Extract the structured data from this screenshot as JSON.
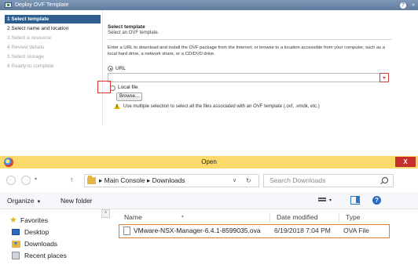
{
  "wizard": {
    "title": "Deploy OVF Template",
    "help_label": "?",
    "expand_label": "»",
    "steps": [
      {
        "label": "1  Select template",
        "state": "active"
      },
      {
        "label": "2  Select name and location",
        "state": "current"
      },
      {
        "label": "3  Select a resource",
        "state": "disabled"
      },
      {
        "label": "4  Review details",
        "state": "disabled"
      },
      {
        "label": "5  Select storage",
        "state": "disabled"
      },
      {
        "label": "6  Ready to complete",
        "state": "disabled"
      }
    ],
    "section_title": "Select template",
    "section_subtitle": "Select an OVF template.",
    "description": "Enter a URL to download and install the OVF package from the Internet, or browse to a location accessible from your computer, such as a local hard drive, a network share, or a CD/DVD drive.",
    "url_option_label": "URL",
    "url_value": "",
    "local_file_label": "Local file",
    "browse_label": "Browse...",
    "warning_text": "Use multiple selection to select all the files associated with an OVF template (.ovf, .vmdk, etc.)",
    "highlight_color": "#e0302a"
  },
  "open_dialog": {
    "title": "Open",
    "close_label": "X",
    "back_label": "←",
    "forward_label": "→",
    "up_label": "↑",
    "address": "▸ Main Console ▸ Downloads",
    "address_dropdown": "∨",
    "refresh_label": "↻",
    "search_placeholder": "Search Downloads",
    "organize_label": "Organize",
    "new_folder_label": "New folder",
    "view_dropdown": "▾",
    "help_label": "?",
    "nav": {
      "scroll_up": "˄",
      "items": [
        {
          "label": "Favorites",
          "icon": "star-icon"
        },
        {
          "label": "Desktop",
          "icon": "desktop-icon"
        },
        {
          "label": "Downloads",
          "icon": "downloads-folder-icon"
        },
        {
          "label": "Recent places",
          "icon": "recent-places-icon"
        }
      ]
    },
    "columns": [
      "Name",
      "Date modified",
      "Type"
    ],
    "files": [
      {
        "name": "VMware-NSX-Manager-6.4.1-8599035.ova",
        "date": "6/19/2018 7:04 PM",
        "type": "OVA File"
      }
    ],
    "titlebar_color": "#fbd96a",
    "selection_color": "#e07d2c"
  }
}
